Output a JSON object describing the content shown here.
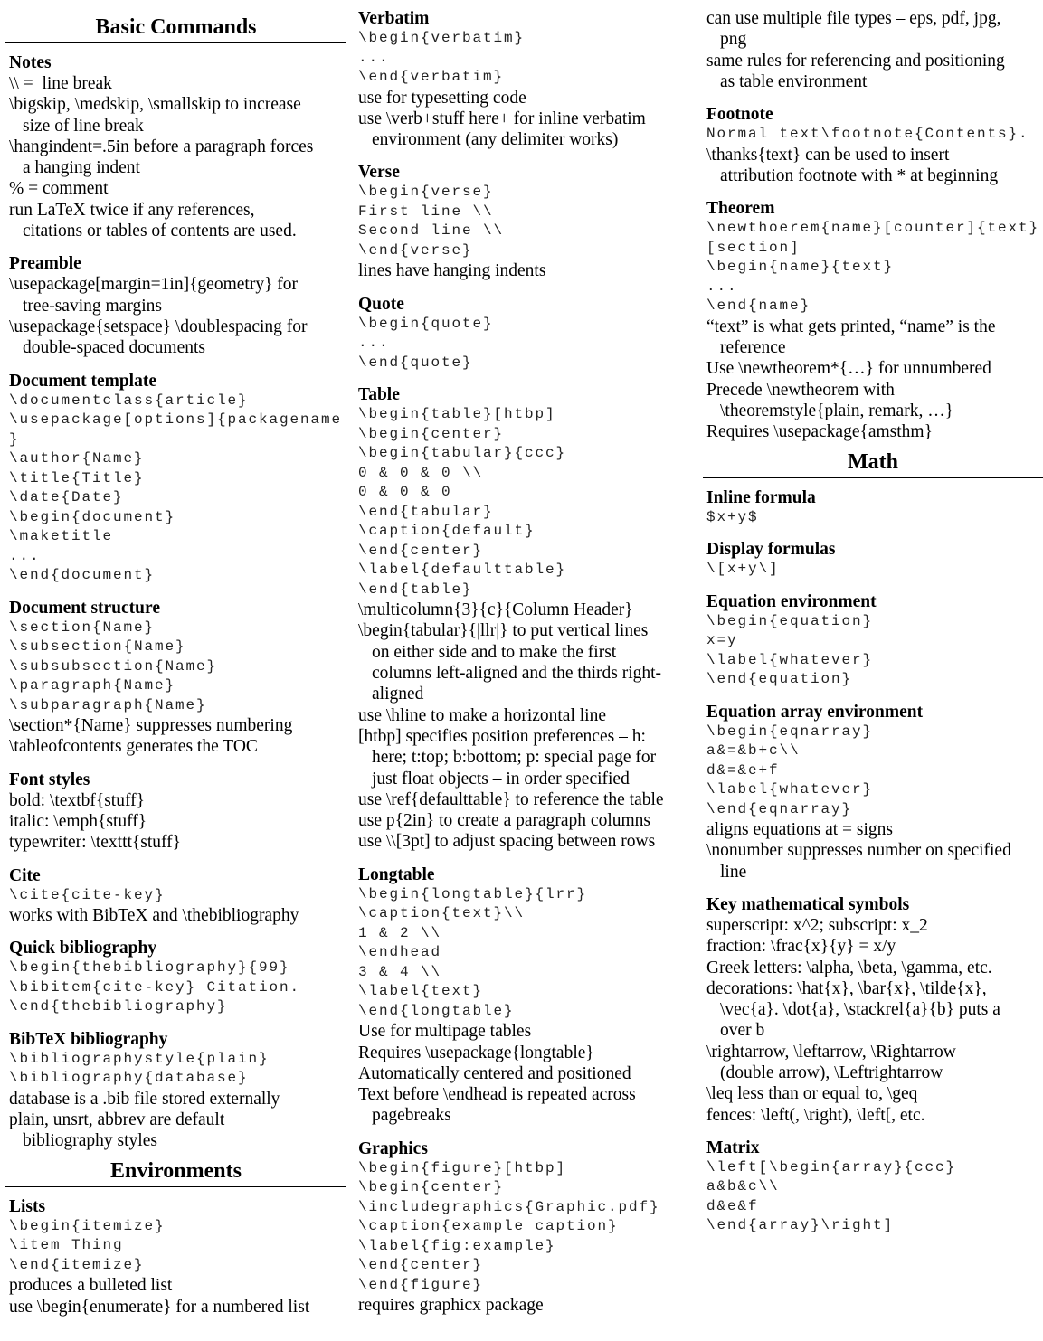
{
  "columns": [
    {
      "items": [
        [
          "h",
          "Basic Commands"
        ],
        [
          "s",
          "Notes"
        ],
        [
          "p",
          "\\\\ =  line break"
        ],
        [
          "p",
          "\\bigskip, \\medskip, \\smallskip to increase\nsize of line break"
        ],
        [
          "p",
          "\\hangindent=.5in before a paragraph forces\na hanging indent"
        ],
        [
          "p",
          "% = comment"
        ],
        [
          "p",
          "run LaTeX twice if any references,\ncitations or tables of contents are used."
        ],
        [
          "s",
          "Preamble"
        ],
        [
          "p",
          "\\usepackage[margin=1in]{geometry} for\ntree-saving margins"
        ],
        [
          "p",
          "\\usepackage{setspace} \\doublespacing for\ndouble-spaced documents"
        ],
        [
          "s",
          "Document template"
        ],
        [
          "c",
          "\\documentclass{article}"
        ],
        [
          "c",
          "\\usepackage[options]{packagename"
        ],
        [
          "c",
          "}"
        ],
        [
          "c",
          "\\author{Name}"
        ],
        [
          "c",
          "\\title{Title}"
        ],
        [
          "c",
          "\\date{Date}"
        ],
        [
          "c",
          "\\begin{document}"
        ],
        [
          "c",
          "\\maketitle"
        ],
        [
          "c",
          "..."
        ],
        [
          "c",
          "\\end{document}"
        ],
        [
          "s",
          "Document structure"
        ],
        [
          "c",
          "\\section{Name}"
        ],
        [
          "c",
          "\\subsection{Name}"
        ],
        [
          "c",
          "\\subsubsection{Name}"
        ],
        [
          "c",
          "\\paragraph{Name}"
        ],
        [
          "c",
          "\\subparagraph{Name}"
        ],
        [
          "p",
          "\\section*{Name} suppresses numbering"
        ],
        [
          "p",
          "\\tableofcontents generates the TOC"
        ],
        [
          "s",
          "Font styles"
        ],
        [
          "p",
          "bold: \\textbf{stuff}"
        ],
        [
          "p",
          "italic: \\emph{stuff}"
        ],
        [
          "p",
          "typewriter: \\texttt{stuff}"
        ],
        [
          "s",
          "Cite"
        ],
        [
          "c",
          "\\cite{cite-key}"
        ],
        [
          "p",
          "works with BibTeX and \\thebibliography"
        ],
        [
          "s",
          "Quick bibliography"
        ],
        [
          "c",
          "\\begin{thebibliography}{99}"
        ],
        [
          "c",
          "\\bibitem{cite-key} Citation."
        ],
        [
          "c",
          "\\end{thebibliography}"
        ],
        [
          "s",
          "BibTeX bibliography"
        ],
        [
          "c",
          "\\bibliographystyle{plain}"
        ],
        [
          "c",
          "\\bibliography{database}"
        ],
        [
          "p",
          "database is a .bib file stored externally"
        ],
        [
          "p",
          "plain, unsrt, abbrev are default\nbibliography styles"
        ],
        [
          "h",
          "Environments"
        ],
        [
          "s",
          "Lists"
        ],
        [
          "c",
          "\\begin{itemize}"
        ],
        [
          "c",
          "\\item Thing"
        ],
        [
          "c",
          "\\end{itemize}"
        ],
        [
          "p",
          "produces a bulleted list"
        ],
        [
          "p",
          "use \\begin{enumerate} for a numbered list"
        ]
      ]
    },
    {
      "items": [
        [
          "s",
          "Verbatim"
        ],
        [
          "c",
          "\\begin{verbatim}"
        ],
        [
          "c",
          "..."
        ],
        [
          "c",
          "\\end{verbatim}"
        ],
        [
          "p",
          "use for typesetting code"
        ],
        [
          "p",
          "use \\verb+stuff here+ for inline verbatim\nenvironment (any delimiter works)"
        ],
        [
          "s",
          "Verse"
        ],
        [
          "c",
          "\\begin{verse}"
        ],
        [
          "c",
          "First line \\\\"
        ],
        [
          "c",
          "Second line \\\\"
        ],
        [
          "c",
          "\\end{verse}"
        ],
        [
          "p",
          "lines have hanging indents"
        ],
        [
          "s",
          "Quote"
        ],
        [
          "c",
          "\\begin{quote}"
        ],
        [
          "c",
          "..."
        ],
        [
          "c",
          "\\end{quote}"
        ],
        [
          "s",
          "Table"
        ],
        [
          "c",
          "\\begin{table}[htbp]"
        ],
        [
          "c",
          "\\begin{center}"
        ],
        [
          "c",
          "\\begin{tabular}{ccc}"
        ],
        [
          "c",
          "0 & 0 & 0 \\\\"
        ],
        [
          "c",
          "0 & 0 & 0"
        ],
        [
          "c",
          "\\end{tabular}"
        ],
        [
          "c",
          "\\caption{default}"
        ],
        [
          "c",
          "\\end{center}"
        ],
        [
          "c",
          "\\label{defaulttable}"
        ],
        [
          "c",
          "\\end{table}"
        ],
        [
          "p",
          "\\multicolumn{3}{c}{Column Header}"
        ],
        [
          "p",
          "\\begin{tabular}{|llr|} to put vertical lines\non either side and to make the first\ncolumns left-aligned and the thirds right-\naligned"
        ],
        [
          "p",
          "use \\hline to make a horizontal line"
        ],
        [
          "p",
          "[htbp] specifies position preferences – h:\nhere; t:top; b:bottom; p: special page for\njust float objects – in order specified"
        ],
        [
          "p",
          "use \\ref{defaulttable} to reference the table"
        ],
        [
          "p",
          "use p{2in} to create a paragraph columns"
        ],
        [
          "p",
          "use \\\\[3pt] to adjust spacing between rows"
        ],
        [
          "s",
          "Longtable"
        ],
        [
          "c",
          "\\begin{longtable}{lrr}"
        ],
        [
          "c",
          "\\caption{text}\\\\"
        ],
        [
          "c",
          "1 & 2 \\\\"
        ],
        [
          "c",
          "\\endhead"
        ],
        [
          "c",
          "3 & 4 \\\\"
        ],
        [
          "c",
          "\\label{text}"
        ],
        [
          "c",
          "\\end{longtable}"
        ],
        [
          "p",
          "Use for multipage tables"
        ],
        [
          "p",
          "Requires \\usepackage{longtable}"
        ],
        [
          "p",
          "Automatically centered and positioned"
        ],
        [
          "p",
          "Text before \\endhead is repeated across\npagebreaks"
        ],
        [
          "s",
          "Graphics"
        ],
        [
          "c",
          "\\begin{figure}[htbp]"
        ],
        [
          "c",
          "\\begin{center}"
        ],
        [
          "c",
          "\\includegraphics{Graphic.pdf}"
        ],
        [
          "c",
          "\\caption{example caption}"
        ],
        [
          "c",
          "\\label{fig:example}"
        ],
        [
          "c",
          "\\end{center}"
        ],
        [
          "c",
          "\\end{figure}"
        ],
        [
          "p",
          "requires graphicx package"
        ]
      ]
    },
    {
      "items": [
        [
          "p",
          "can use multiple file types – eps, pdf, jpg,\npng"
        ],
        [
          "p",
          "same rules for referencing and positioning\nas table environment"
        ],
        [
          "s",
          "Footnote"
        ],
        [
          "c",
          "Normal text\\footnote{Contents}."
        ],
        [
          "p",
          "\\thanks{text} can be used to insert\nattribution footnote with * at beginning"
        ],
        [
          "s",
          "Theorem"
        ],
        [
          "c",
          "\\newthoerem{name}[counter]{text}"
        ],
        [
          "c",
          "[section]"
        ],
        [
          "c",
          "\\begin{name}{text}"
        ],
        [
          "c",
          "..."
        ],
        [
          "c",
          "\\end{name}"
        ],
        [
          "p",
          "“text” is what gets printed, “name” is the\nreference"
        ],
        [
          "p",
          "Use \\newtheorem*{…} for unnumbered"
        ],
        [
          "p",
          "Precede \\newtheorem with\n\\theoremstyle{plain, remark, …}"
        ],
        [
          "p",
          "Requires \\usepackage{amsthm}"
        ],
        [
          "h",
          "Math"
        ],
        [
          "s",
          "Inline formula"
        ],
        [
          "c",
          "$x+y$"
        ],
        [
          "s",
          "Display formulas"
        ],
        [
          "c",
          "\\[x+y\\]"
        ],
        [
          "s",
          "Equation environment"
        ],
        [
          "c",
          "\\begin{equation}"
        ],
        [
          "c",
          "x=y"
        ],
        [
          "c",
          "\\label{whatever}"
        ],
        [
          "c",
          "\\end{equation}"
        ],
        [
          "s",
          "Equation array environment"
        ],
        [
          "c",
          "\\begin{eqnarray}"
        ],
        [
          "c",
          "a&=&b+c\\\\"
        ],
        [
          "c",
          "d&=&e+f"
        ],
        [
          "c",
          "\\label{whatever}"
        ],
        [
          "c",
          "\\end{eqnarray}"
        ],
        [
          "p",
          "aligns equations at = signs"
        ],
        [
          "p",
          "\\nonumber suppresses number on specified\nline"
        ],
        [
          "s",
          "Key mathematical symbols"
        ],
        [
          "p",
          "superscript: x^2; subscript: x_2"
        ],
        [
          "p",
          "fraction: \\frac{x}{y} = x/y"
        ],
        [
          "p",
          "Greek letters: \\alpha, \\beta, \\gamma, etc."
        ],
        [
          "p",
          "decorations: \\hat{x}, \\bar{x}, \\tilde{x},\n\\vec{a}. \\dot{a}, \\stackrel{a}{b} puts a\nover b"
        ],
        [
          "p",
          "\\rightarrow, \\leftarrow, \\Rightarrow\n(double arrow), \\Leftrightarrow"
        ],
        [
          "p",
          "\\leq less than or equal to, \\geq"
        ],
        [
          "p",
          "fences: \\left(, \\right), \\left[, etc."
        ],
        [
          "s",
          "Matrix"
        ],
        [
          "c",
          "\\left[\\begin{array}{ccc}"
        ],
        [
          "c",
          "a&b&c\\\\"
        ],
        [
          "c",
          "d&e&f"
        ],
        [
          "c",
          "\\end{array}\\right]"
        ]
      ]
    }
  ]
}
